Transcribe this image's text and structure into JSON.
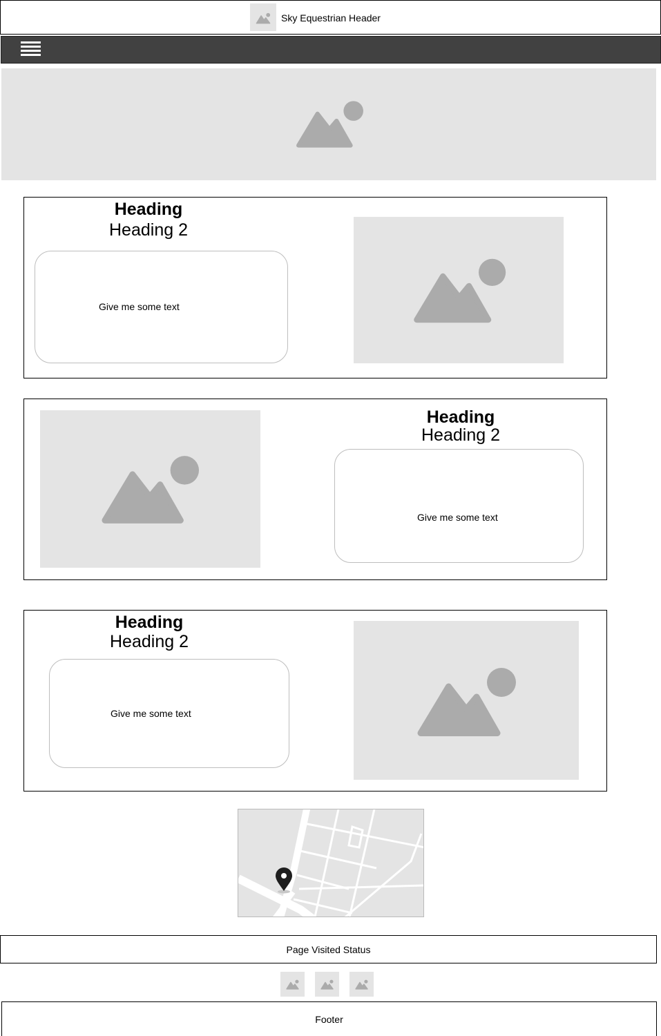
{
  "header": {
    "title": "Sky Equestrian Header",
    "logo_icon": "image-placeholder-icon"
  },
  "nav": {
    "menu_icon": "hamburger-menu-icon"
  },
  "sections": [
    {
      "heading": "Heading",
      "subheading": "Heading 2",
      "body": "Give me some text"
    },
    {
      "heading": "Heading",
      "subheading": "Heading 2",
      "body": "Give me some text"
    },
    {
      "heading": "Heading",
      "subheading": "Heading 2",
      "body": "Give me some text"
    }
  ],
  "map": {
    "pin_icon": "location-pin-icon"
  },
  "status": {
    "label": "Page Visited Status"
  },
  "social_icons": [
    "image-placeholder-icon",
    "image-placeholder-icon",
    "image-placeholder-icon"
  ],
  "footer": {
    "label": "Footer"
  },
  "colors": {
    "nav_bg": "#414141",
    "placeholder_bg": "#e4e4e4",
    "placeholder_icon": "#ababab"
  }
}
